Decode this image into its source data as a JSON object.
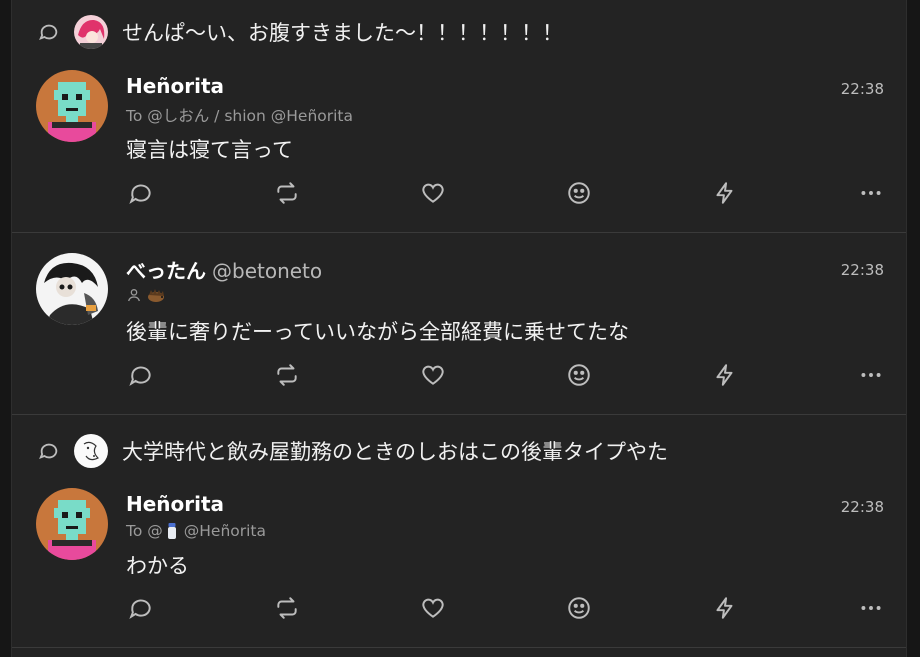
{
  "posts": [
    {
      "context_text": "せんぱ〜い、お腹すきました〜！！！！！！！",
      "name": "Heñorita",
      "handle": "",
      "time": "22:38",
      "reply_prefix": "To @しおん / shion @Heñorita",
      "body": "寝言は寝て言って"
    },
    {
      "context_text": "",
      "name": "べったん",
      "handle": "@betoneto",
      "time": "22:38",
      "reply_prefix": "",
      "body": "後輩に奢りだーっていいながら全部経費に乗せてたな"
    },
    {
      "context_text": "大学時代と飲み屋勤務のときのしおはこの後輩タイプやた",
      "name": "Heñorita",
      "handle": "",
      "time": "22:38",
      "reply_prefix_a": "To @",
      "reply_prefix_b": "@Heñorita",
      "body": "わかる"
    }
  ],
  "icons": {
    "context": "speech-bubble-icon",
    "actions": [
      "reply-icon",
      "renote-icon",
      "like-icon",
      "reaction-icon",
      "quick-action-icon",
      "more-icon"
    ]
  },
  "colors": {
    "background": "#232323",
    "text": "#f2f2f2",
    "muted": "#9a9a9a",
    "icon": "#bdbdbd"
  }
}
